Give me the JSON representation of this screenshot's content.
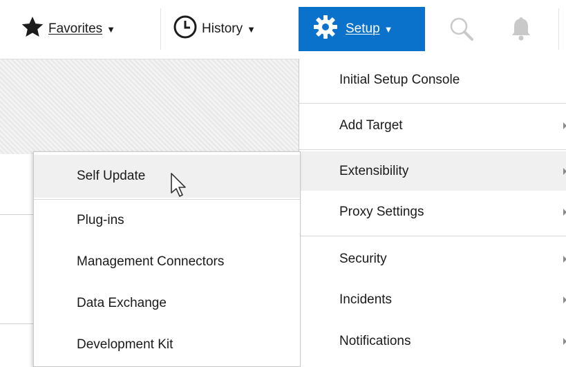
{
  "toolbar": {
    "favorites": {
      "label": "Favorites",
      "icon": "star-icon"
    },
    "history": {
      "label": "History",
      "icon": "clock-icon"
    },
    "setup": {
      "label": "Setup",
      "icon": "gear-icon",
      "color": "#0b72cc"
    },
    "search_icon": "search-icon",
    "notifications_icon": "bell-icon"
  },
  "setup_menu": {
    "items": [
      {
        "label": "Initial Setup Console",
        "has_submenu": false
      },
      {
        "label": "Add Target",
        "has_submenu": true
      },
      {
        "label": "Extensibility",
        "has_submenu": true,
        "highlighted": true
      },
      {
        "label": "Proxy Settings",
        "has_submenu": true
      },
      {
        "label": "Security",
        "has_submenu": true
      },
      {
        "label": "Incidents",
        "has_submenu": true
      },
      {
        "label": "Notifications",
        "has_submenu": true
      }
    ]
  },
  "extensibility_submenu": {
    "items": [
      {
        "label": "Self Update",
        "highlighted": true
      },
      {
        "label": "Plug-ins"
      },
      {
        "label": "Management Connectors"
      },
      {
        "label": "Data Exchange"
      },
      {
        "label": "Development Kit"
      }
    ]
  },
  "colors": {
    "setup_active": "#0b72cc",
    "menu_highlight": "#f0f0f0",
    "text": "#1a1a1a"
  }
}
